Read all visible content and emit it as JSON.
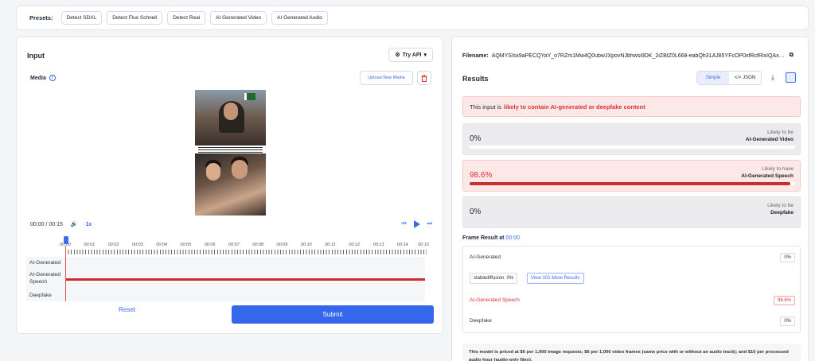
{
  "presets": {
    "label": "Presets:",
    "items": [
      "Detect SDXL",
      "Detect Flux Schnell",
      "Detect Real",
      "AI Generated Video",
      "AI Generated Audio"
    ]
  },
  "input": {
    "title": "Input",
    "try_api": "Try API",
    "media_label": "Media",
    "upload_label": "Upload New Media",
    "time": "00:00 / 00:15",
    "speed": "1x",
    "ticks": [
      "00:00",
      "00:01",
      "00:02",
      "00:03",
      "00:04",
      "00:05",
      "00:06",
      "00:07",
      "00:08",
      "00:09",
      "00:10",
      "00:11",
      "00:12",
      "00:13",
      "00:14",
      "00:15"
    ],
    "tracks": [
      "AI-Generated",
      "AI-Generated Speech",
      "Deepfake"
    ],
    "reset": "Reset",
    "submit": "Submit"
  },
  "results": {
    "filename_label": "Filename:",
    "filename": "AQMYSIsx9aPECQYaY_o7RZm1Mw4Q0ubwJXpovNJbhwsi9DK_2iZBtZ0L668-eabQh31AJ85YFcOP0xfRcfRlxIQAxsIUNMS...",
    "title": "Results",
    "toggle_simple": "Simple",
    "toggle_json": "</> JSON",
    "alert_prefix": "This input is",
    "alert_emph": "likely to contain AI-generated or deepfake content",
    "cards": [
      {
        "pct": "0%",
        "sub": "Likely to be",
        "main": "AI-Generated Video",
        "value": 0
      },
      {
        "pct": "98.6%",
        "sub": "Likely to have",
        "main": "AI-Generated Speech",
        "value": 0.986
      },
      {
        "pct": "0%",
        "sub": "Likely to be",
        "main": "Deepfake",
        "value": 0
      }
    ],
    "frame_result_label": "Frame Result at",
    "frame_result_time": "00:00",
    "frame": {
      "ai_label": "AI-Generated",
      "ai_pct": "0%",
      "pill_sd": "stablediffusion: 0%",
      "pill_more": "View 101 More Results",
      "speech_label": "AI-Generated Speech",
      "speech_pct": "98.6%",
      "deepfake_label": "Deepfake",
      "deepfake_pct": "0%"
    },
    "pricing": "This model is priced at $6 per 1,000 image requests; $6 per 1,000 video frames (same price with or without an audio track); and $10 per processed audio hour (audio-only files)."
  },
  "colors": {
    "accent": "#3467ec",
    "danger": "#c82e2e"
  }
}
